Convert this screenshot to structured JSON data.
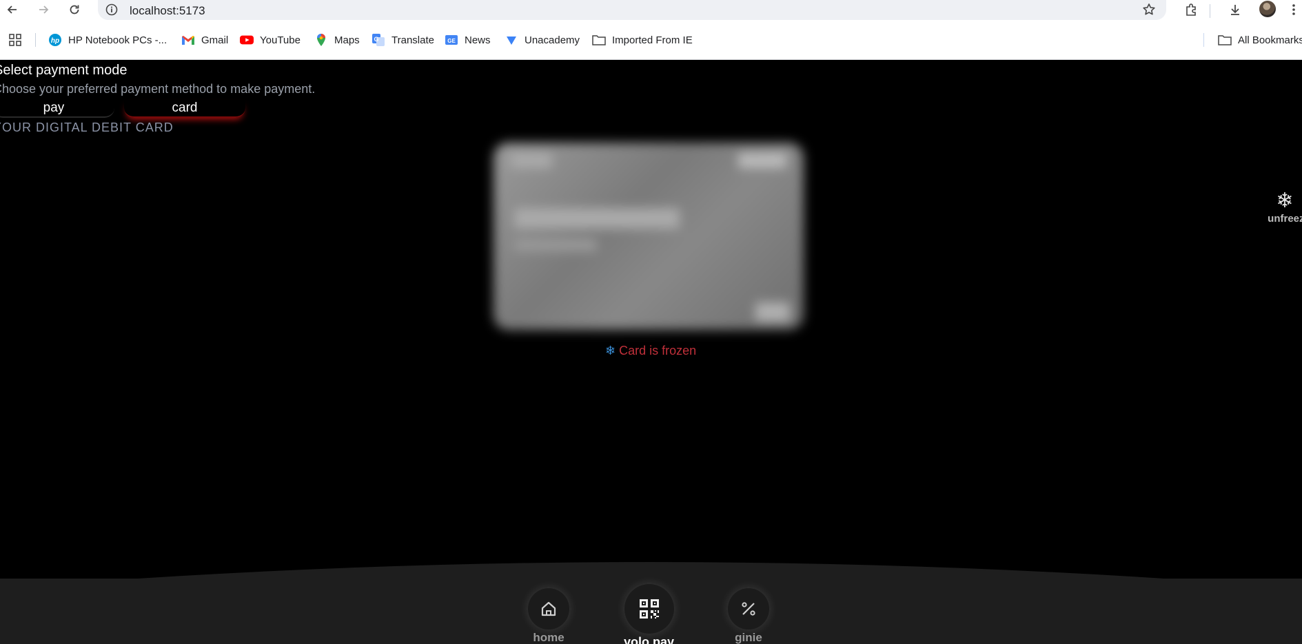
{
  "browser": {
    "url": "localhost:5173",
    "bookmarks": [
      {
        "label": "HP Notebook PCs -...",
        "icon": "hp-icon"
      },
      {
        "label": "Gmail",
        "icon": "gmail-icon"
      },
      {
        "label": "YouTube",
        "icon": "youtube-icon"
      },
      {
        "label": "Maps",
        "icon": "maps-icon"
      },
      {
        "label": "Translate",
        "icon": "translate-icon"
      },
      {
        "label": "News",
        "icon": "news-icon"
      },
      {
        "label": "Unacademy",
        "icon": "unacademy-icon"
      },
      {
        "label": "Imported From IE",
        "icon": "folder-icon"
      }
    ],
    "all_bookmarks": "All Bookmarks"
  },
  "payment": {
    "title": "Select payment mode",
    "subtitle": "Choose your preferred payment method to make payment.",
    "tabs": [
      "pay",
      "card"
    ],
    "active_tab": "card",
    "section_label": "YOUR DIGITAL DEBIT CARD",
    "status": "Card is frozen",
    "unfreeze_label": "unfreeze"
  },
  "nav": {
    "items": [
      {
        "label": "home",
        "icon": "home-icon"
      },
      {
        "label": "yolo pay",
        "icon": "qr-code-icon",
        "active": true
      },
      {
        "label": "ginie",
        "icon": "percent-icon"
      }
    ]
  },
  "colors": {
    "background": "#000000",
    "frozen_text": "#c0303a",
    "snowflake": "#3a8fd8",
    "card_tab_glow": "#d21414",
    "nav_bar": "#1e1e1e"
  }
}
